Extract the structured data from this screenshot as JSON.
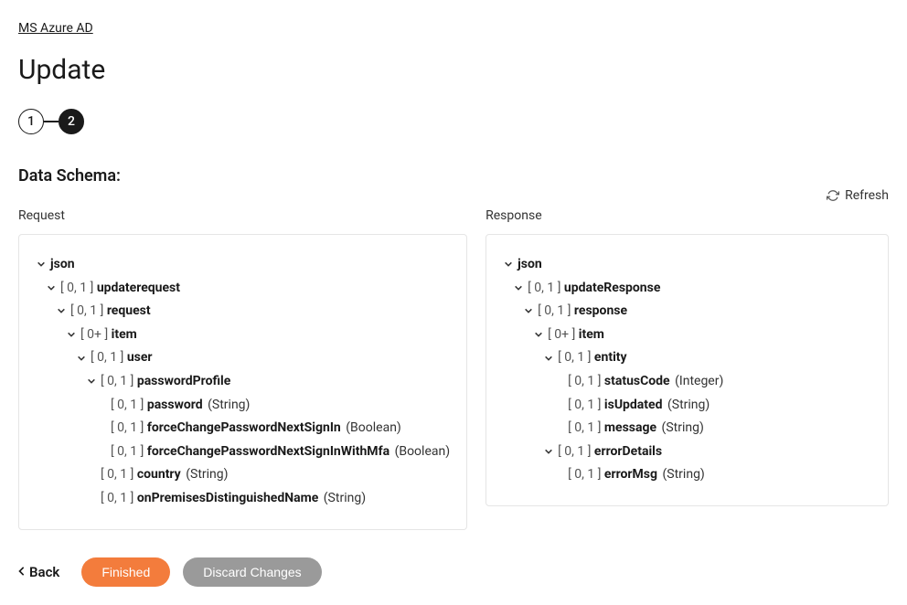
{
  "breadcrumb": "MS Azure AD",
  "page_title": "Update",
  "stepper": {
    "step1": "1",
    "step2": "2"
  },
  "section_title": "Data Schema:",
  "labels": {
    "request": "Request",
    "response": "Response",
    "refresh": "Refresh"
  },
  "request_tree": [
    {
      "depth": 0,
      "expand": true,
      "card": "",
      "name": "json",
      "type": ""
    },
    {
      "depth": 1,
      "expand": true,
      "card": "[ 0, 1 ]",
      "name": "updaterequest",
      "type": ""
    },
    {
      "depth": 2,
      "expand": true,
      "card": "[ 0, 1 ]",
      "name": "request",
      "type": ""
    },
    {
      "depth": 3,
      "expand": true,
      "card": "[ 0+ ]",
      "name": "item",
      "type": ""
    },
    {
      "depth": 4,
      "expand": true,
      "card": "[ 0, 1 ]",
      "name": "user",
      "type": ""
    },
    {
      "depth": 5,
      "expand": true,
      "card": "[ 0, 1 ]",
      "name": "passwordProfile",
      "type": ""
    },
    {
      "depth": 6,
      "expand": false,
      "card": "[ 0, 1 ]",
      "name": "password",
      "type": "(String)"
    },
    {
      "depth": 6,
      "expand": false,
      "card": "[ 0, 1 ]",
      "name": "forceChangePasswordNextSignIn",
      "type": "(Boolean)"
    },
    {
      "depth": 6,
      "expand": false,
      "card": "[ 0, 1 ]",
      "name": "forceChangePasswordNextSignInWithMfa",
      "type": "(Boolean)"
    },
    {
      "depth": 5,
      "expand": false,
      "card": "[ 0, 1 ]",
      "name": "country",
      "type": "(String)"
    },
    {
      "depth": 5,
      "expand": false,
      "card": "[ 0, 1 ]",
      "name": "onPremisesDistinguishedName",
      "type": "(String)"
    }
  ],
  "response_tree": [
    {
      "depth": 0,
      "expand": true,
      "card": "",
      "name": "json",
      "type": ""
    },
    {
      "depth": 1,
      "expand": true,
      "card": "[ 0, 1 ]",
      "name": "updateResponse",
      "type": ""
    },
    {
      "depth": 2,
      "expand": true,
      "card": "[ 0, 1 ]",
      "name": "response",
      "type": ""
    },
    {
      "depth": 3,
      "expand": true,
      "card": "[ 0+ ]",
      "name": "item",
      "type": ""
    },
    {
      "depth": 4,
      "expand": true,
      "card": "[ 0, 1 ]",
      "name": "entity",
      "type": ""
    },
    {
      "depth": 5,
      "expand": false,
      "card": "[ 0, 1 ]",
      "name": "statusCode",
      "type": "(Integer)"
    },
    {
      "depth": 5,
      "expand": false,
      "card": "[ 0, 1 ]",
      "name": "isUpdated",
      "type": "(String)"
    },
    {
      "depth": 5,
      "expand": false,
      "card": "[ 0, 1 ]",
      "name": "message",
      "type": "(String)"
    },
    {
      "depth": 4,
      "expand": true,
      "card": "[ 0, 1 ]",
      "name": "errorDetails",
      "type": ""
    },
    {
      "depth": 5,
      "expand": false,
      "card": "[ 0, 1 ]",
      "name": "errorMsg",
      "type": "(String)"
    }
  ],
  "footer": {
    "back": "Back",
    "finished": "Finished",
    "discard": "Discard Changes"
  }
}
